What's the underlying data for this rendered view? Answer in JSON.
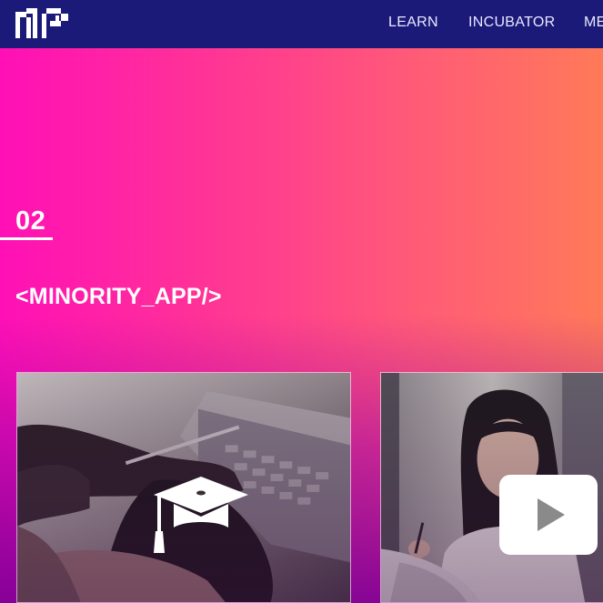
{
  "nav": {
    "logo_icon": "mp-pixel-logo-icon",
    "links": [
      {
        "label": "LEARN"
      },
      {
        "label": "INCUBATOR"
      },
      {
        "label": "ME"
      }
    ]
  },
  "section": {
    "number": "02",
    "title": "<MINORITY_APP/>"
  },
  "cards": [
    {
      "photo": "hands-on-laptop-keyboard-photo",
      "icon": "graduation-cap-icon"
    },
    {
      "photo": "woman-taking-notes-photo",
      "icon": "play-icon"
    }
  ],
  "colors": {
    "navbar": "#1b1a78",
    "hero_gradient_start": "#ff10b6",
    "hero_gradient_end": "#ff7a58",
    "hero_bottom": "#800096",
    "text": "#ffffff"
  }
}
